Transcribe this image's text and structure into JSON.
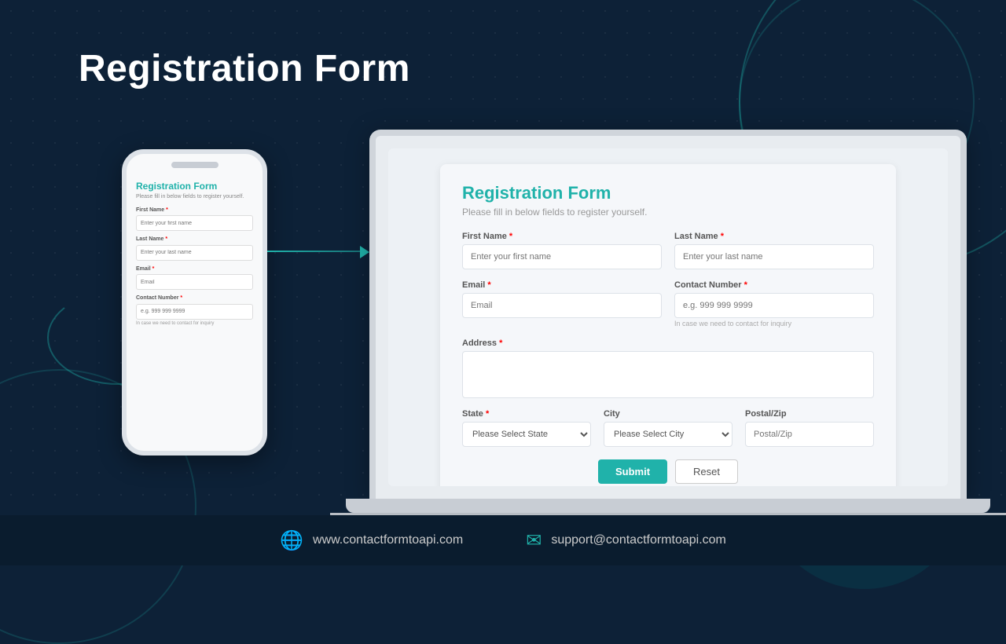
{
  "page": {
    "title": "Registration Form",
    "bg_color": "#0d2137"
  },
  "phone_form": {
    "title": "Registration Form",
    "subtitle": "Please fill in below fields to register yourself.",
    "fields": [
      {
        "label": "First Name",
        "required": true,
        "placeholder": "Enter your first name"
      },
      {
        "label": "Last Name",
        "required": true,
        "placeholder": "Enter your last name"
      },
      {
        "label": "Email",
        "required": true,
        "placeholder": "Email"
      },
      {
        "label": "Contact Number",
        "required": true,
        "placeholder": "e.g. 999 999 9999",
        "hint": "In case we need to contact for inquiry"
      }
    ]
  },
  "laptop_form": {
    "title": "Registration Form",
    "subtitle": "Please fill in below fields to register yourself.",
    "fields": {
      "first_name": {
        "label": "First Name",
        "required": true,
        "placeholder": "Enter your first name"
      },
      "last_name": {
        "label": "Last Name",
        "required": true,
        "placeholder": "Enter your last name"
      },
      "email": {
        "label": "Email",
        "required": true,
        "placeholder": "Email"
      },
      "contact": {
        "label": "Contact Number",
        "required": true,
        "placeholder": "e.g. 999 999 9999",
        "hint": "In case we need to contact for inquiry"
      },
      "address": {
        "label": "Address",
        "required": true,
        "placeholder": ""
      },
      "state": {
        "label": "State",
        "required": true,
        "placeholder": "Please Select State"
      },
      "city": {
        "label": "City",
        "required": false,
        "placeholder": "Please Select City"
      },
      "postal": {
        "label": "Postal/Zip",
        "required": false,
        "placeholder": "Postal/Zip"
      }
    },
    "buttons": {
      "submit": "Submit",
      "reset": "Reset"
    }
  },
  "footer": {
    "website": "www.contactformtoapi.com",
    "email": "support@contactformtoapi.com"
  }
}
